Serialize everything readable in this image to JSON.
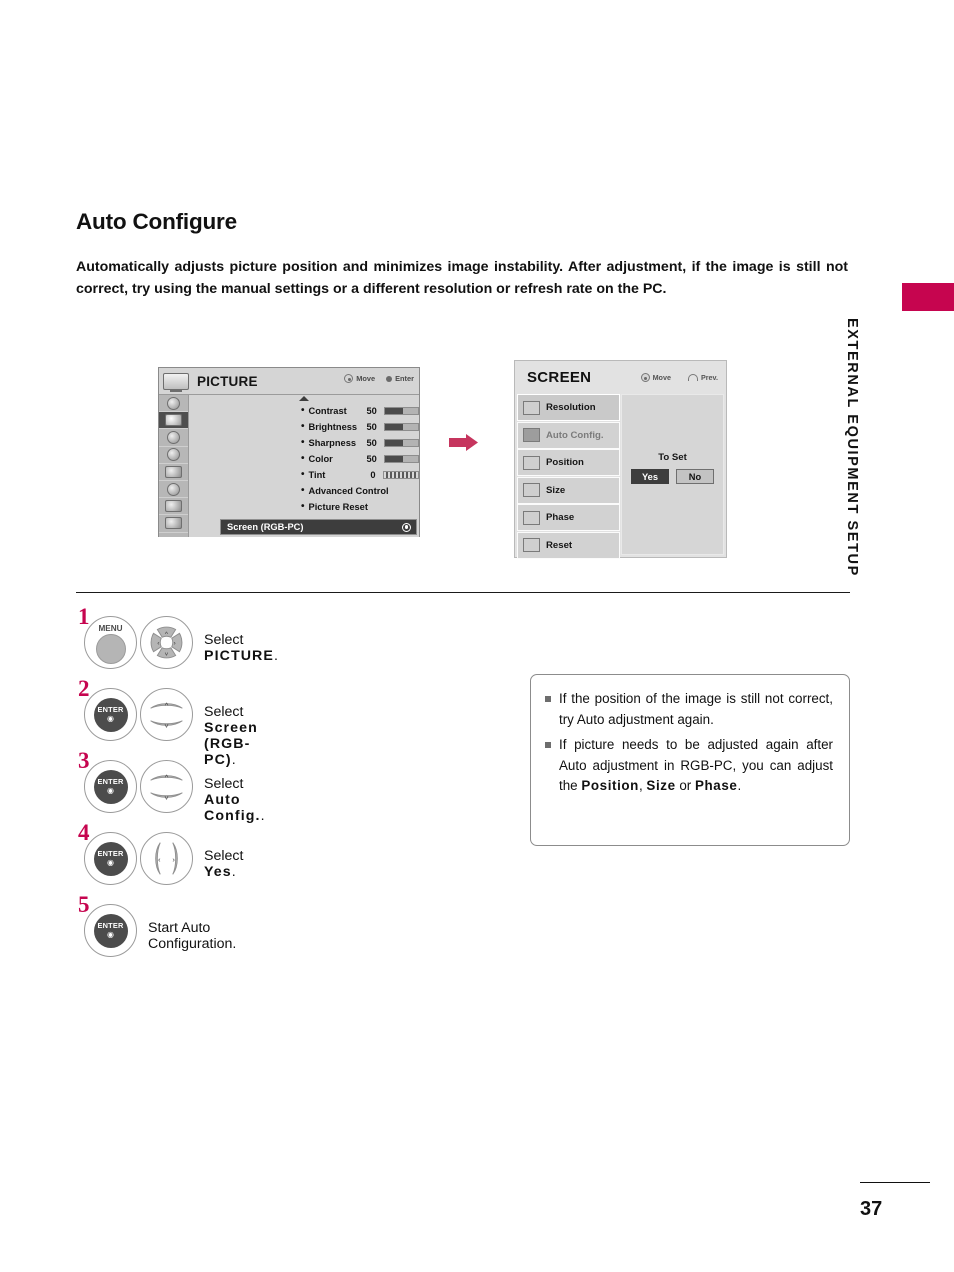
{
  "chapter": {
    "tab_label": "EXTERNAL EQUIPMENT SETUP",
    "accent": "#c6054f"
  },
  "heading": {
    "title": "Auto Configure"
  },
  "intro": {
    "text": "Automatically adjusts picture position and minimizes image instability. After adjustment, if the image is still not correct, try using the manual settings or a different resolution or refresh rate on the PC."
  },
  "picture_osd": {
    "title": "PICTURE",
    "hints": {
      "move": "Move",
      "enter": "Enter"
    },
    "rows": [
      {
        "label": "Contrast",
        "value": "50",
        "bar": 55
      },
      {
        "label": "Brightness",
        "value": "50",
        "bar": 55
      },
      {
        "label": "Sharpness",
        "value": "50",
        "bar": 55
      },
      {
        "label": "Color",
        "value": "50",
        "bar": 55
      },
      {
        "label": "Tint",
        "value": "0",
        "bar": -1
      },
      {
        "label": "Advanced Control",
        "value": "",
        "bar": -1
      },
      {
        "label": "Picture Reset",
        "value": "",
        "bar": -1
      }
    ],
    "selected_row": "Screen (RGB-PC)"
  },
  "screen_osd": {
    "title": "SCREEN",
    "hints": {
      "move": "Move",
      "prev": "Prev."
    },
    "items": [
      {
        "label": "Resolution",
        "state": "highlighted"
      },
      {
        "label": "Auto Config.",
        "state": "current"
      },
      {
        "label": "Position",
        "state": "normal"
      },
      {
        "label": "Size",
        "state": "normal"
      },
      {
        "label": "Phase",
        "state": "normal"
      },
      {
        "label": "Reset",
        "state": "normal"
      }
    ],
    "to_set_label": "To Set",
    "yes_label": "Yes",
    "no_label": "No"
  },
  "steps": [
    {
      "num": "1",
      "button_a": "MENU",
      "button_b": "4-way",
      "text_prefix": "Select ",
      "text_bold": "PICTURE",
      "text_suffix": "."
    },
    {
      "num": "2",
      "button_a": "ENTER",
      "button_b": "updown",
      "text_prefix": "Select ",
      "text_bold": "Screen (RGB-PC)",
      "text_suffix": "."
    },
    {
      "num": "3",
      "button_a": "ENTER",
      "button_b": "updown",
      "text_prefix": "Select ",
      "text_bold": "Auto Config.",
      "text_suffix": "."
    },
    {
      "num": "4",
      "button_a": "ENTER",
      "button_b": "leftright",
      "text_prefix": "Select ",
      "text_bold": "Yes",
      "text_suffix": "."
    },
    {
      "num": "5",
      "button_a": "ENTER",
      "button_b": "",
      "text_prefix": "Start Auto Configuration.",
      "text_bold": "",
      "text_suffix": ""
    }
  ],
  "enter_label": "ENTER",
  "menu_label": "MENU",
  "notes": [
    {
      "parts": [
        {
          "t": "If the position of the image is still not correct, try Auto adjustment again.",
          "b": false
        }
      ]
    },
    {
      "parts": [
        {
          "t": "If picture needs to be adjusted again after Auto adjustment in RGB-PC, you can adjust the ",
          "b": false
        },
        {
          "t": "Position",
          "b": true
        },
        {
          "t": ", ",
          "b": false
        },
        {
          "t": "Size",
          "b": true
        },
        {
          "t": " or ",
          "b": false
        },
        {
          "t": "Phase",
          "b": true
        },
        {
          "t": ".",
          "b": false
        }
      ]
    }
  ],
  "footer": {
    "page_number": "37"
  }
}
